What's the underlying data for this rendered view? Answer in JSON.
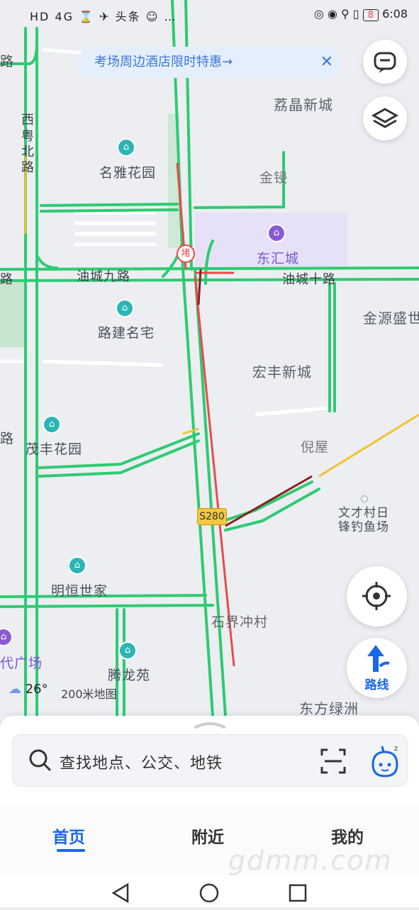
{
  "status_bar": {
    "left_indicators": "HD 4G ⌛ ✈ 头条 ☺ … ",
    "battery_level": "8",
    "time": "6:08"
  },
  "banner": {
    "text": "考场周边酒店限时特惠→",
    "close_icon": "close-icon"
  },
  "map": {
    "labels": {
      "lijing": "荔晶新城",
      "xiyue_1": "西",
      "xiyue_2": "粤",
      "xiyue_3": "北",
      "xiyue_4": "路",
      "mingya": "名雅花园",
      "jinxin": "金锓",
      "donghui": "东汇城",
      "youcheng9": "油城九路",
      "youcheng10": "油城十路",
      "jinyuan": "金源盛世",
      "lujian": "路建名宅",
      "hongfeng": "宏丰新城",
      "maofeng": "茂丰花园",
      "niwu": "倪屋",
      "s280": "S280",
      "wencai_1": "文才村日",
      "wencai_2": "锋钓鱼场",
      "mingheng": "明恒世家",
      "shijie": "石界冲村",
      "shidai": "代广场",
      "tenglong": "腾龙苑",
      "dongfang": "东方绿洲",
      "lu_a": "路",
      "lu_b": "路",
      "lu_c": "路",
      "du": "堵"
    },
    "weather": "26°",
    "scale": "200米地图",
    "colors": {
      "road_green": "#2ecb72",
      "road_red": "#e84b4b",
      "road_darkred": "#8b1e1e",
      "road_yellow": "#f2c230",
      "accent": "#1a66e8"
    }
  },
  "controls": {
    "message_icon": "message-icon",
    "layers_icon": "layers-icon",
    "locate_icon": "locate-icon",
    "route_label": "路线"
  },
  "search": {
    "placeholder": "查找地点、公交、地铁",
    "scan_icon": "scan-icon",
    "assistant_icon": "assistant-icon"
  },
  "tabs": [
    {
      "label": "首页",
      "active": true
    },
    {
      "label": "附近",
      "active": false
    },
    {
      "label": "我的",
      "active": false
    }
  ],
  "watermark": "gdmm.com"
}
